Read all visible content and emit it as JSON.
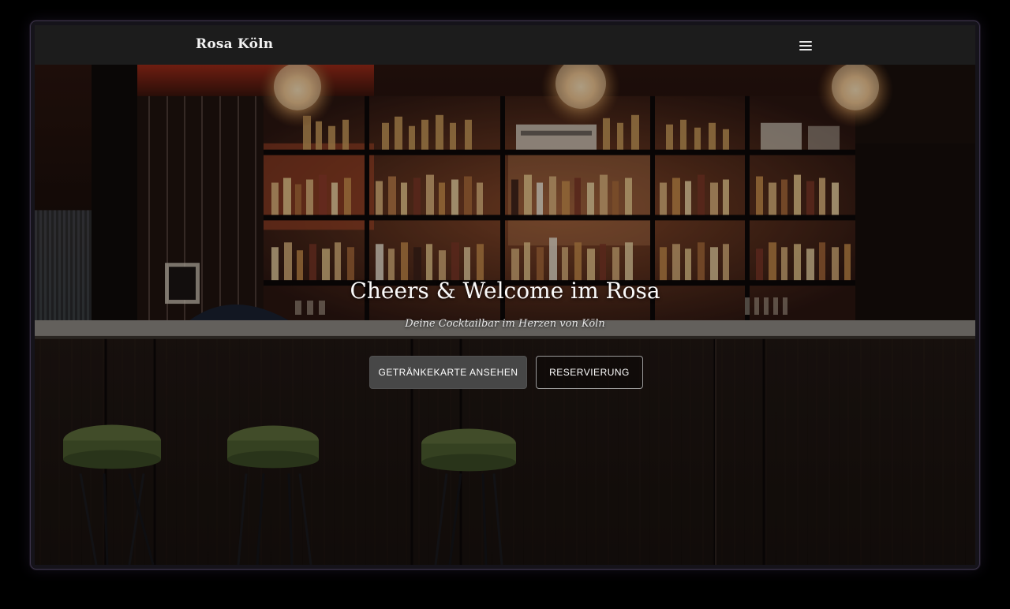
{
  "navbar": {
    "brand": "Rosa Köln",
    "menu_icon": "hamburger-menu-icon"
  },
  "hero": {
    "title": "Cheers & Welcome im Rosa",
    "subtitle": "Deine Cocktailbar im Herzen von Köln",
    "background": "bar-interior-photo",
    "buttons": {
      "drinks_label": "GETRÄNKEKARTE ANSEHEN",
      "reservation_label": "RESERVIERUNG"
    }
  },
  "colors": {
    "page_background": "#000000",
    "navbar_background": "#1c1c1c",
    "primary_button": "#474747",
    "text": "#ffffff"
  }
}
